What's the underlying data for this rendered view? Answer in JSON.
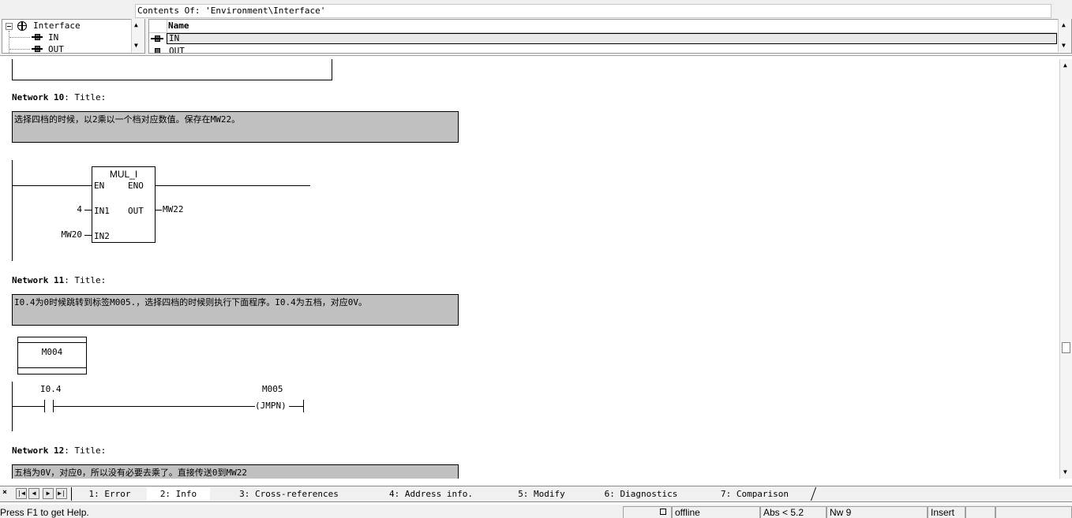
{
  "interface": {
    "contents_label": "Contents Of: 'Environment\\Interface'",
    "tree": {
      "root": "Interface",
      "children": [
        "IN",
        "OUT"
      ]
    },
    "list": {
      "column_header": "Name",
      "rows": [
        "IN",
        "OUT"
      ]
    }
  },
  "editor": {
    "networks": [
      {
        "label": "Network 10",
        "title_label": "Title:",
        "comment": "选择四档的时候，以2乘以一个档对应数值。保存在MW22。",
        "block": {
          "name": "MUL_I",
          "pins": {
            "en": "EN",
            "eno": "ENO",
            "in1": "IN1",
            "in2": "IN2",
            "out": "OUT"
          },
          "in1_operand": "4",
          "in2_operand": "MW20",
          "out_operand": "MW22"
        }
      },
      {
        "label": "Network 11",
        "title_label": "Title:",
        "comment": "I0.4为0时候跳转到标签M005.，选择四档的时候则执行下面程序。I0.4为五档，对应0V。",
        "jump_label": "M004",
        "contact": "I0.4",
        "jump_target": "M005",
        "jump_coil": "(JMPN)"
      },
      {
        "label": "Network 12",
        "title_label": "Title:",
        "comment": "五档为0V，对应0，所以没有必要去乘了。直接传送0到MW22"
      }
    ]
  },
  "tabs": [
    "1: Error",
    "2: Info",
    "3: Cross-references",
    "4: Address info.",
    "5: Modify",
    "6: Diagnostics",
    "7: Comparison"
  ],
  "status": {
    "help": "Press F1 to get Help.",
    "mode": "offline",
    "abs": "Abs < 5.2",
    "network": "Nw 9",
    "insert": "Insert"
  },
  "icons": {
    "tree_expander": "minus-box-icon",
    "interface_icon": "interface-globe-icon",
    "param_icon": "parameter-icon",
    "scroll_up": "triangle-up-icon",
    "scroll_down": "triangle-down-icon",
    "nav_first": "first-icon",
    "nav_prev": "prev-icon",
    "nav_next": "next-icon",
    "nav_last": "last-icon",
    "online_status": "network-computer-icon"
  },
  "colors": {
    "comment_bg": "#c0c0c0",
    "selection_row": "#e8e8e8"
  }
}
